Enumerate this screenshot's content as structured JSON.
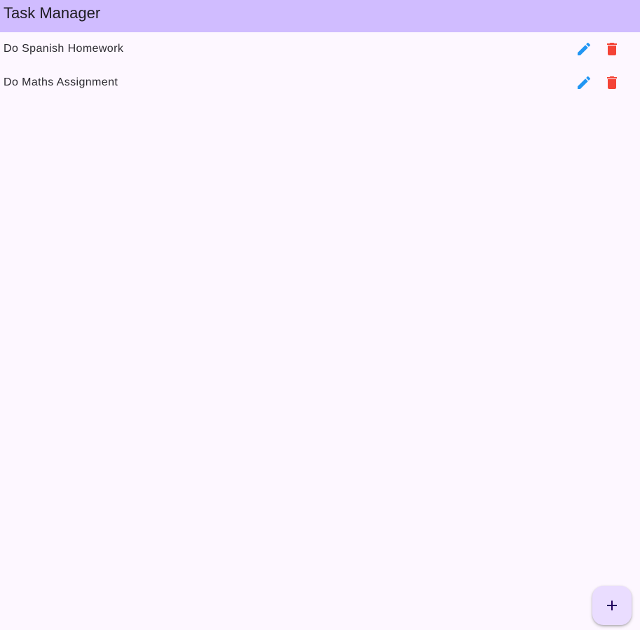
{
  "app": {
    "title": "Task Manager"
  },
  "colors": {
    "app_bar": "#d0bcff",
    "background": "#fdf7ff",
    "edit_icon": "#2196f3",
    "delete_icon": "#f44336",
    "fab": "#eaddff"
  },
  "tasks": [
    {
      "label": "Do Spanish Homework",
      "edit_icon": "edit-icon",
      "delete_icon": "delete-icon"
    },
    {
      "label": "Do Maths Assignment",
      "edit_icon": "edit-icon",
      "delete_icon": "delete-icon"
    }
  ],
  "fab": {
    "icon": "plus-icon"
  }
}
